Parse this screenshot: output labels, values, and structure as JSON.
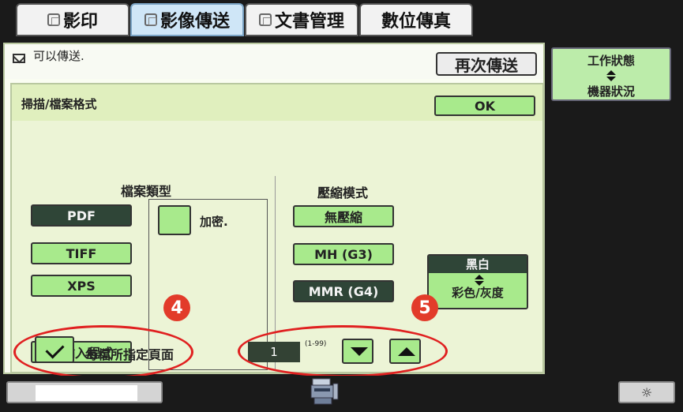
{
  "tabs": [
    {
      "label": "影印",
      "icon": "copy-icon"
    },
    {
      "label": "影像傳送",
      "icon": "image-send-icon",
      "active": true
    },
    {
      "label": "文書管理",
      "icon": "document-icon"
    },
    {
      "label": "數位傳真"
    }
  ],
  "status": {
    "text": "可以傳送.",
    "resend_label": "再次傳送"
  },
  "panel": {
    "title": "掃描/檔案格式",
    "ok_label": "OK",
    "file_type_label": "檔案類型",
    "file_types": [
      "PDF",
      "TIFF",
      "XPS"
    ],
    "selected_file_type": "PDF",
    "encrypt_label": "加密.",
    "program_label": "已輸入程式",
    "compression_label": "壓縮模式",
    "compression_modes": [
      "無壓縮",
      "MH (G3)",
      "MMR (G4)"
    ],
    "selected_compression": "MMR (G4)",
    "color_toggle": {
      "top": "黑白",
      "bottom": "彩色/灰度"
    },
    "pages_per_file_label": "每檔所指定頁面",
    "pages_per_file_checked": true,
    "pages_value": "1",
    "pages_range": "(1-99)"
  },
  "callouts": [
    "4",
    "5"
  ],
  "sidebar": {
    "line1": "工作狀態",
    "line2": "機器狀況"
  },
  "bottom": {
    "progress_fill": 0.68,
    "brightness_icon": "☼"
  },
  "colors": {
    "button_green": "#a8ea8c",
    "selected_dark": "#2f4537",
    "callout_red": "#e23b2a"
  }
}
